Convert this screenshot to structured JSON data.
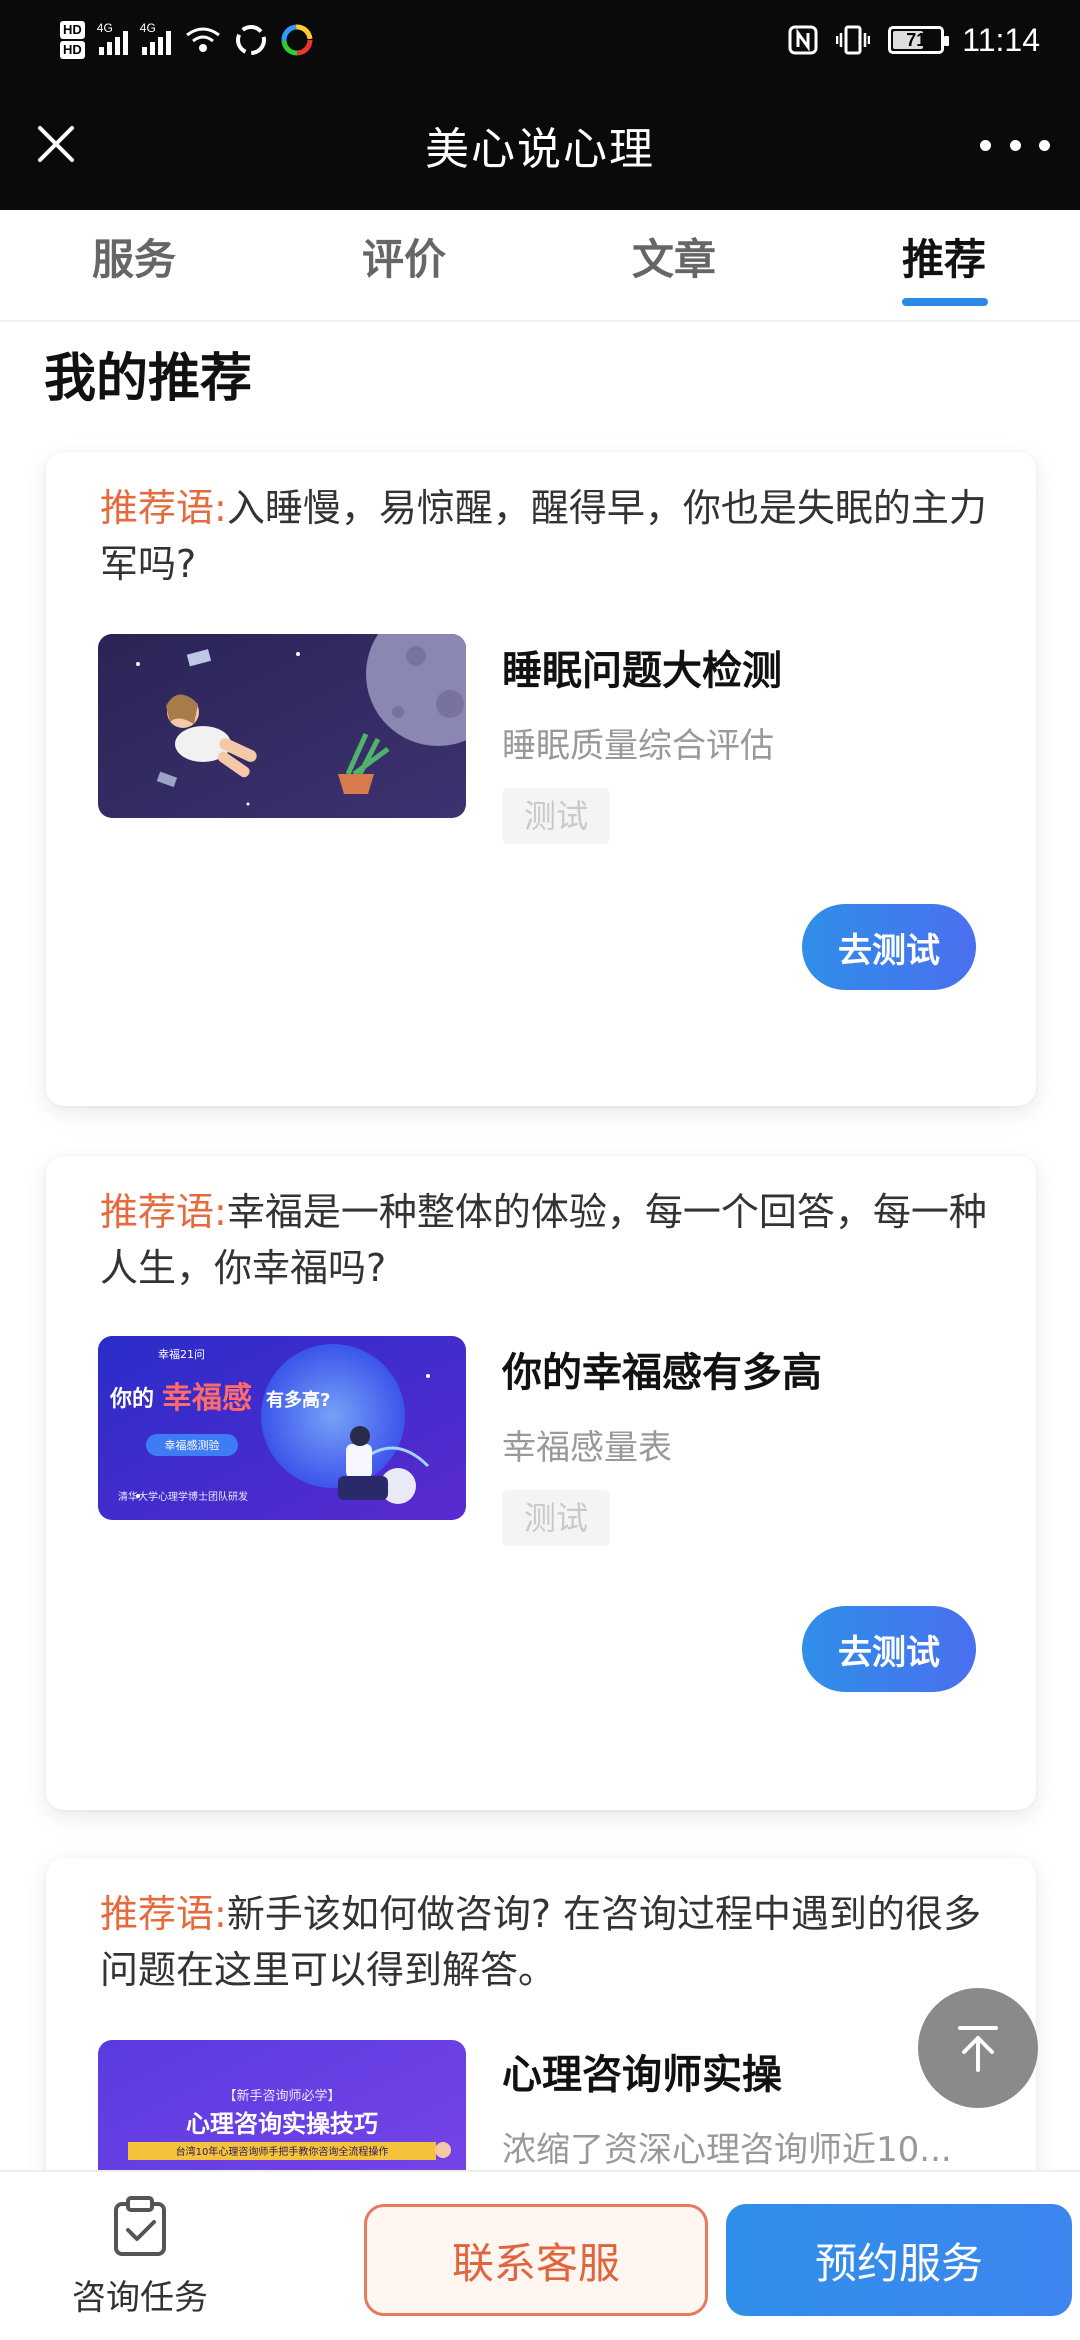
{
  "status_bar": {
    "hd1": "HD",
    "hd2": "HD",
    "sim1_label": "4G",
    "sim2_label": "4G",
    "battery": "71",
    "time": "11:14"
  },
  "header": {
    "title": "美心说心理"
  },
  "tabs": [
    {
      "label": "服务",
      "active": false
    },
    {
      "label": "评价",
      "active": false
    },
    {
      "label": "文章",
      "active": false
    },
    {
      "label": "推荐",
      "active": true
    }
  ],
  "section_title": "我的推荐",
  "cards": [
    {
      "rec_label": "推荐语:",
      "rec_text": "入睡慢，易惊醒，醒得早，你也是失眠的主力军吗?",
      "title": "睡眠问题大检测",
      "subtitle": "睡眠质量综合评估",
      "tag": "测试",
      "button": "去测试"
    },
    {
      "rec_label": "推荐语:",
      "rec_text": "幸福是一种整体的体验，每一个回答，每一种人生，你幸福吗?",
      "title": "你的幸福感有多高",
      "subtitle": "幸福感量表",
      "tag": "测试",
      "button": "去测试",
      "thumb": {
        "top_text": "幸福21问",
        "headline_pre": "你的",
        "headline_mid": "幸福感",
        "headline_post": "有多高?",
        "pill": "幸福感测验",
        "foot": "清华大学心理学博士团队研发"
      }
    },
    {
      "rec_label": "推荐语:",
      "rec_text": "新手该如何做咨询? 在咨询过程中遇到的很多问题在这里可以得到解答。",
      "title": "心理咨询师实操",
      "subtitle": "浓缩了资深心理咨询师近10...",
      "thumb": {
        "top_text": "【新手咨询师必学】",
        "headline": "心理咨询实操技巧",
        "foot": "台湾10年心理咨询师手把手教你咨询全流程操作"
      }
    }
  ],
  "bottom_bar": {
    "task_label": "咨询任务",
    "contact_label": "联系客服",
    "book_label": "预约服务"
  },
  "colors": {
    "accent_blue": "#2a8ae6",
    "rec_label_orange": "#e56a3c",
    "header_bg": "#0a0a0a"
  }
}
